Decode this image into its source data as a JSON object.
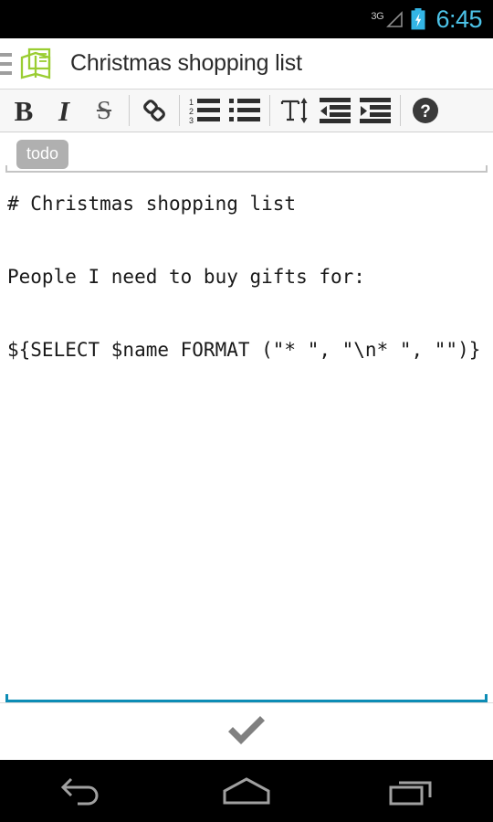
{
  "status_bar": {
    "network_type": "3G",
    "signal_icon": "signal-triangle-icon",
    "battery_icon": "battery-charging-icon",
    "clock": "6:45",
    "clock_color": "#4cc3e8",
    "battery_color": "#33b5e5"
  },
  "action_bar": {
    "drawer_icon": "hamburger-menu-icon",
    "app_logo_icon": "notebook-logo-icon",
    "logo_color": "#9acd32",
    "title": "Christmas shopping list"
  },
  "format_toolbar": {
    "buttons": [
      {
        "name": "bold-button",
        "glyph": "B",
        "icon": "bold-icon"
      },
      {
        "name": "italic-button",
        "glyph": "I",
        "icon": "italic-icon"
      },
      {
        "name": "strikethrough-button",
        "glyph": "S",
        "icon": "strikethrough-icon"
      },
      {
        "name": "link-button",
        "glyph": "",
        "icon": "link-chain-icon"
      },
      {
        "name": "numbered-list-button",
        "glyph": "",
        "icon": "numbered-list-icon"
      },
      {
        "name": "bulleted-list-button",
        "glyph": "",
        "icon": "bulleted-list-icon"
      },
      {
        "name": "text-size-button",
        "glyph": "",
        "icon": "text-size-icon"
      },
      {
        "name": "outdent-button",
        "glyph": "",
        "icon": "outdent-icon"
      },
      {
        "name": "indent-button",
        "glyph": "",
        "icon": "indent-icon"
      },
      {
        "name": "help-button",
        "glyph": "",
        "icon": "help-circle-icon"
      }
    ],
    "list_numbers": [
      "1",
      "2",
      "3"
    ]
  },
  "tags_field": {
    "tags": [
      "todo"
    ],
    "placeholder": "",
    "underline_color": "#c4c4c4"
  },
  "note_editor": {
    "content": "# Christmas shopping list\n\nPeople I need to buy gifts for:\n\n${SELECT $name FORMAT (\"* \", \"\\n* \", \"\")}",
    "focus_underline_color": "#0d8cb5"
  },
  "confirm_bar": {
    "icon": "checkmark-icon",
    "label": "",
    "color": "#808080"
  },
  "nav_bar": {
    "back_icon": "back-arrow-icon",
    "home_icon": "home-icon",
    "recents_icon": "recent-apps-icon",
    "color": "#a0a0a0"
  }
}
